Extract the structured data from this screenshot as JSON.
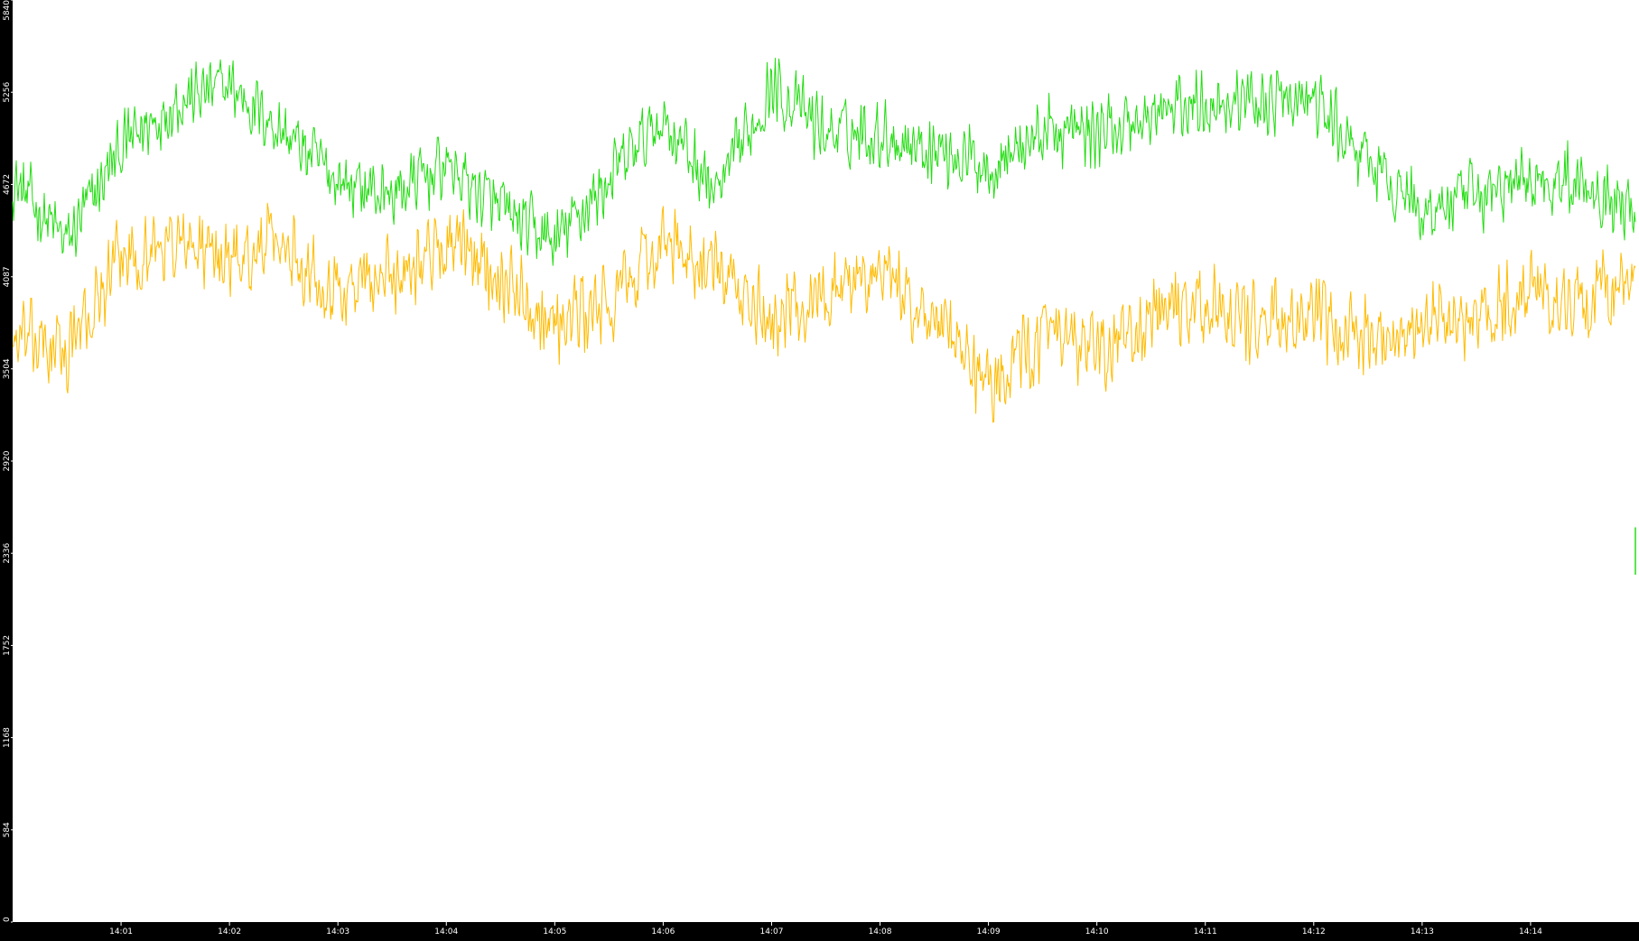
{
  "chart_data": {
    "type": "line",
    "title": "",
    "xlabel": "",
    "ylabel": "",
    "ylim": [
      0,
      5840
    ],
    "yticks": [
      0,
      584,
      1168,
      1752,
      2336,
      2920,
      3504,
      4087,
      4672,
      5256,
      5840
    ],
    "xlim": [
      "14:00:00",
      "14:15:00"
    ],
    "xticks": [
      "14:01",
      "14:02",
      "14:03",
      "14:04",
      "14:05",
      "14:06",
      "14:07",
      "14:08",
      "14:09",
      "14:10",
      "14:11",
      "14:12",
      "14:13",
      "14:14"
    ],
    "grid": false,
    "legend": "none",
    "colors": {
      "background": "#000000",
      "plot_area": "#ffffff",
      "axis": "#000000",
      "tick_label": "#ffffff"
    },
    "series": [
      {
        "color": "#22dd11",
        "x": [
          "14:00:00",
          "14:00:30",
          "14:01:00",
          "14:01:30",
          "14:02:00",
          "14:02:30",
          "14:03:00",
          "14:03:30",
          "14:04:00",
          "14:04:30",
          "14:05:00",
          "14:05:30",
          "14:06:00",
          "14:06:30",
          "14:07:00",
          "14:07:30",
          "14:08:00",
          "14:08:30",
          "14:09:00",
          "14:09:30",
          "14:10:00",
          "14:10:30",
          "14:11:00",
          "14:11:30",
          "14:12:00",
          "14:12:30",
          "14:13:00",
          "14:13:30",
          "14:14:00",
          "14:14:30",
          "14:14:58"
        ],
        "y": [
          4700,
          4300,
          4900,
          5200,
          5300,
          5000,
          4700,
          4600,
          4800,
          4500,
          4300,
          4700,
          5100,
          4600,
          5300,
          5000,
          5000,
          4900,
          4800,
          5000,
          5000,
          5100,
          5200,
          5200,
          5200,
          4800,
          4500,
          4600,
          4700,
          4700,
          4500
        ],
        "noise": 260
      },
      {
        "color": "#ffbb00",
        "x": [
          "14:00:00",
          "14:00:30",
          "14:01:00",
          "14:01:30",
          "14:02:00",
          "14:02:30",
          "14:03:00",
          "14:03:30",
          "14:04:00",
          "14:04:30",
          "14:05:00",
          "14:05:30",
          "14:06:00",
          "14:06:30",
          "14:07:00",
          "14:07:30",
          "14:08:00",
          "14:08:30",
          "14:09:00",
          "14:09:30",
          "14:10:00",
          "14:10:30",
          "14:11:00",
          "14:11:30",
          "14:12:00",
          "14:12:30",
          "14:13:00",
          "14:13:30",
          "14:14:00",
          "14:14:30",
          "14:14:58"
        ],
        "y": [
          3700,
          3600,
          4200,
          4300,
          4200,
          4300,
          4000,
          4100,
          4300,
          4100,
          3800,
          3900,
          4300,
          4100,
          3800,
          4000,
          4100,
          3800,
          3400,
          3700,
          3600,
          3800,
          3900,
          3800,
          3800,
          3700,
          3800,
          3800,
          4000,
          3900,
          4100
        ],
        "noise": 300
      }
    ],
    "end_marker": {
      "x": "14:14:58",
      "y": [
        2200,
        2500
      ]
    }
  }
}
